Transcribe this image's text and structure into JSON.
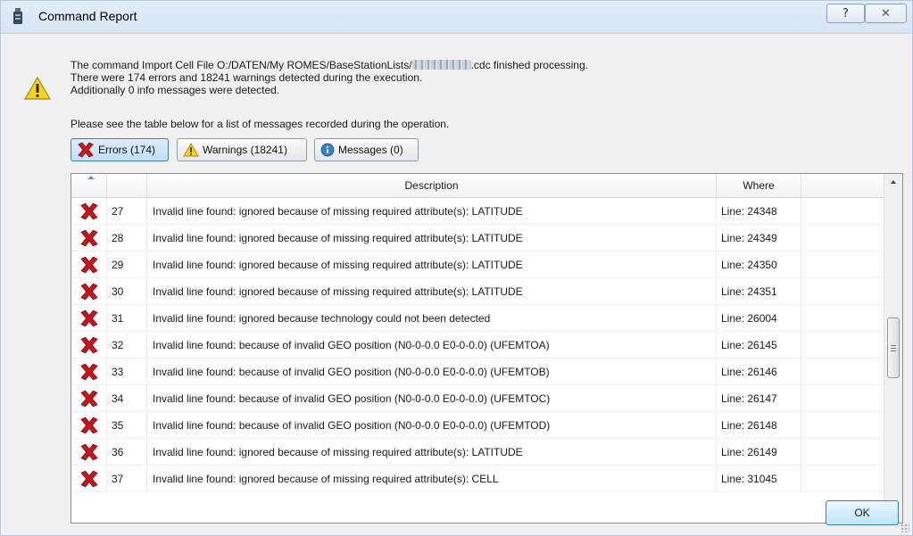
{
  "window": {
    "title": "Command Report",
    "help_label": "?",
    "close_label": "✕"
  },
  "summary": {
    "line1_prefix": "The command Import Cell File O:/DATEN/My ROMES/BaseStationLists/",
    "line1_suffix": ".cdc finished processing.",
    "line2": "There were 174 errors and 18241 warnings detected during the execution.",
    "line3": "Additionally 0 info messages were detected."
  },
  "instruction": "Please see the table below for a list of messages recorded during the operation.",
  "filters": {
    "errors": "Errors (174)",
    "warnings": "Warnings (18241)",
    "messages": "Messages (0)"
  },
  "table": {
    "columns": [
      "",
      "",
      "Description",
      "Where",
      ""
    ],
    "rows": [
      {
        "num": "27",
        "description": "Invalid line found: ignored because of missing required attribute(s): LATITUDE",
        "where": "Line: 24348"
      },
      {
        "num": "28",
        "description": "Invalid line found: ignored because of missing required attribute(s): LATITUDE",
        "where": "Line: 24349"
      },
      {
        "num": "29",
        "description": "Invalid line found: ignored because of missing required attribute(s): LATITUDE",
        "where": "Line: 24350"
      },
      {
        "num": "30",
        "description": "Invalid line found: ignored because of missing required attribute(s): LATITUDE",
        "where": "Line: 24351"
      },
      {
        "num": "31",
        "description": "Invalid line found: ignored because technology could not been detected",
        "where": "Line: 26004"
      },
      {
        "num": "32",
        "description": "Invalid line found: because of invalid GEO position (N0-0-0.0 E0-0-0.0) (UFEMTOA)",
        "where": "Line: 26145"
      },
      {
        "num": "33",
        "description": "Invalid line found: because of invalid GEO position (N0-0-0.0 E0-0-0.0) (UFEMTOB)",
        "where": "Line: 26146"
      },
      {
        "num": "34",
        "description": "Invalid line found: because of invalid GEO position (N0-0-0.0 E0-0-0.0) (UFEMTOC)",
        "where": "Line: 26147"
      },
      {
        "num": "35",
        "description": "Invalid line found: because of invalid GEO position (N0-0-0.0 E0-0-0.0) (UFEMTOD)",
        "where": "Line: 26148"
      },
      {
        "num": "36",
        "description": "Invalid line found: ignored because of missing required attribute(s): LATITUDE",
        "where": "Line: 26149"
      },
      {
        "num": "37",
        "description": "Invalid line found: ignored because of missing required attribute(s): CELL",
        "where": "Line: 31045"
      }
    ]
  },
  "ok_label": "OK",
  "colors": {
    "error": "#c8161d",
    "warning": "#f5d21f",
    "info": "#3b7fd1",
    "accent": "#3c7fb1"
  }
}
